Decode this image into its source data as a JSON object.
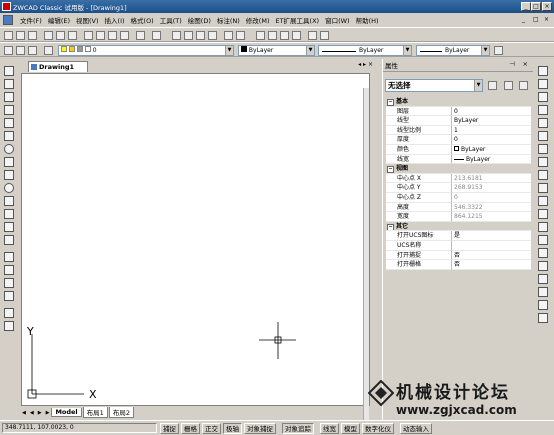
{
  "app": {
    "title": "ZWCAD Classic 试用版 - [Drawing1]",
    "window_buttons": [
      "_",
      "□",
      "×"
    ]
  },
  "menu": {
    "items": [
      "文件(F)",
      "编辑(E)",
      "视图(V)",
      "插入(I)",
      "格式(O)",
      "工具(T)",
      "绘图(D)",
      "标注(N)",
      "修改(M)",
      "ET扩展工具(X)",
      "窗口(W)",
      "帮助(H)"
    ],
    "mdi_buttons": [
      "_",
      "□",
      "×"
    ]
  },
  "toolbar": {
    "layer_value": "0",
    "color_value": "ByLayer",
    "linetype_value": "ByLayer",
    "lineweight_value": "ByLayer"
  },
  "document": {
    "tab_label": "Drawing1",
    "doc_controls": [
      "◂",
      "▸",
      "×"
    ],
    "layout_tabs": [
      "Model",
      "布局1",
      "布局2"
    ],
    "nav_buttons": [
      "◀",
      "◀",
      "▶",
      "▶"
    ],
    "ucs_y": "Y",
    "ucs_x": "X"
  },
  "properties": {
    "title": "属性",
    "selection": "无选择",
    "categories": [
      {
        "name": "基本",
        "rows": [
          {
            "k": "图层",
            "v": "0"
          },
          {
            "k": "线型",
            "v": "ByLayer"
          },
          {
            "k": "线型比例",
            "v": "1"
          },
          {
            "k": "厚度",
            "v": "0"
          },
          {
            "k": "颜色",
            "v": "ByLayer"
          },
          {
            "k": "线宽",
            "v": "ByLayer"
          }
        ]
      },
      {
        "name": "视图",
        "rows": [
          {
            "k": "中心点 X",
            "v": "213.6181"
          },
          {
            "k": "中心点 Y",
            "v": "268.9153"
          },
          {
            "k": "中心点 Z",
            "v": "0"
          },
          {
            "k": "高度",
            "v": "546.3322"
          },
          {
            "k": "宽度",
            "v": "864.1215"
          }
        ]
      },
      {
        "name": "其它",
        "rows": [
          {
            "k": "打开UCS图标",
            "v": "是"
          },
          {
            "k": "UCS名称",
            "v": ""
          },
          {
            "k": "打开捕捉",
            "v": "否"
          },
          {
            "k": "打开栅格",
            "v": "否"
          }
        ]
      }
    ]
  },
  "status": {
    "coords": "348.7111,  107.0023,  0",
    "buttons": [
      "捕捉",
      "栅格",
      "正交",
      "极轴",
      "对象捕捉",
      "对象追踪",
      "线宽",
      "模型",
      "数字化仪",
      "动态输入"
    ]
  },
  "watermark": {
    "line1": "机械设计论坛",
    "line2": "www.zgjxcad.com"
  },
  "colors": {
    "title_bar": "#1b4f8a",
    "canvas": "#ffffff",
    "chrome": "#d4d0c8"
  }
}
